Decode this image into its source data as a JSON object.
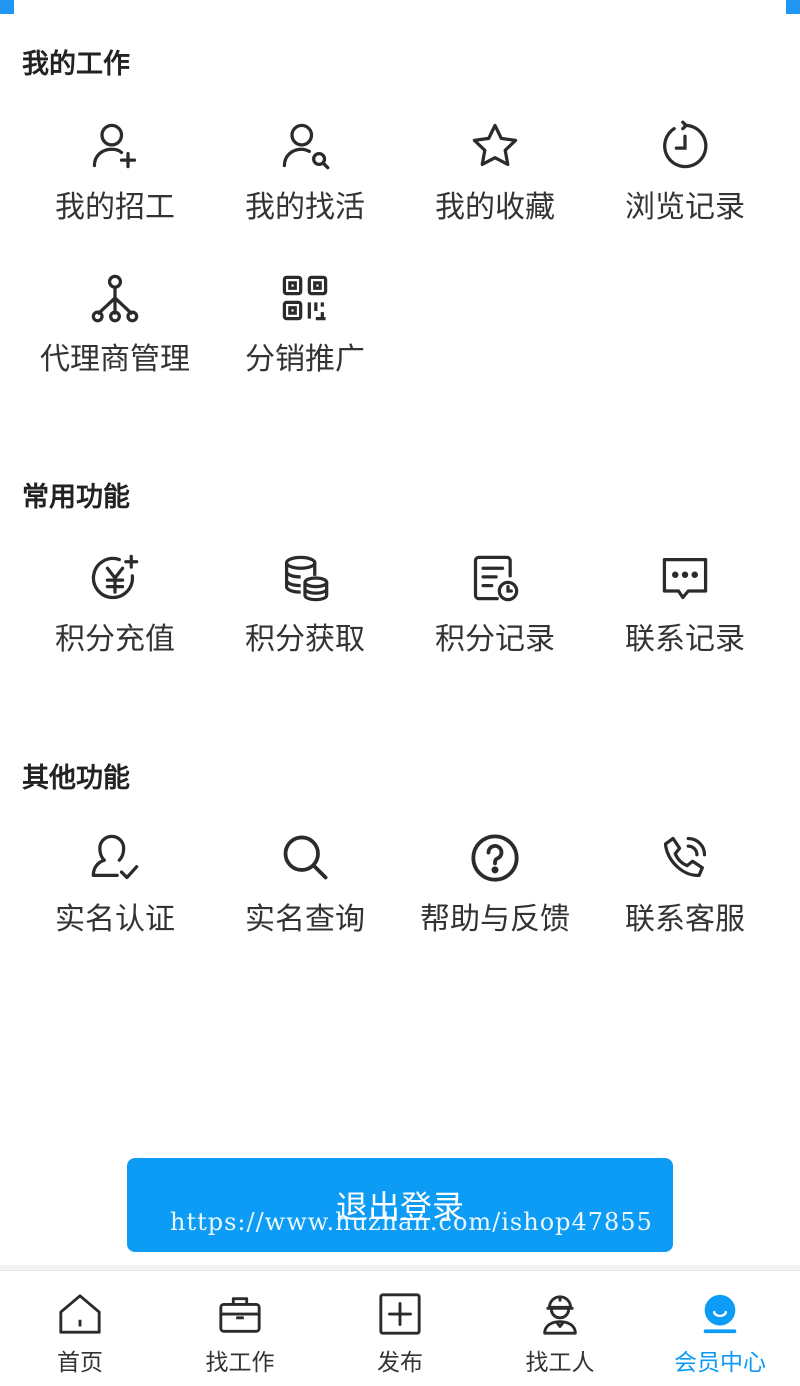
{
  "sections": [
    {
      "title": "我的工作",
      "items": [
        {
          "label": "我的招工",
          "icon": "user-plus-icon"
        },
        {
          "label": "我的找活",
          "icon": "user-search-icon"
        },
        {
          "label": "我的收藏",
          "icon": "star-icon"
        },
        {
          "label": "浏览记录",
          "icon": "history-clock-icon"
        },
        {
          "label": "代理商管理",
          "icon": "hierarchy-icon"
        },
        {
          "label": "分销推广",
          "icon": "qr-code-icon"
        }
      ]
    },
    {
      "title": "常用功能",
      "items": [
        {
          "label": "积分充值",
          "icon": "yen-recharge-icon"
        },
        {
          "label": "积分获取",
          "icon": "coin-stack-icon"
        },
        {
          "label": "积分记录",
          "icon": "record-clock-icon"
        },
        {
          "label": "联系记录",
          "icon": "chat-message-icon"
        }
      ]
    },
    {
      "title": "其他功能",
      "items": [
        {
          "label": "实名认证",
          "icon": "user-verified-icon"
        },
        {
          "label": "实名查询",
          "icon": "search-icon"
        },
        {
          "label": "帮助与反馈",
          "icon": "help-circle-icon"
        },
        {
          "label": "联系客服",
          "icon": "phone-call-icon"
        }
      ]
    }
  ],
  "logout_label": "退出登录",
  "watermark": "https://www.huzhan.com/ishop47855",
  "tabbar": [
    {
      "label": "首页",
      "icon": "home-icon"
    },
    {
      "label": "找工作",
      "icon": "briefcase-icon"
    },
    {
      "label": "发布",
      "icon": "add-square-icon"
    },
    {
      "label": "找工人",
      "icon": "worker-icon"
    },
    {
      "label": "会员中心",
      "icon": "member-icon",
      "active": true
    }
  ],
  "colors": {
    "accent": "#0c9bf5",
    "text": "#333333",
    "background": "#f2f2f2"
  }
}
